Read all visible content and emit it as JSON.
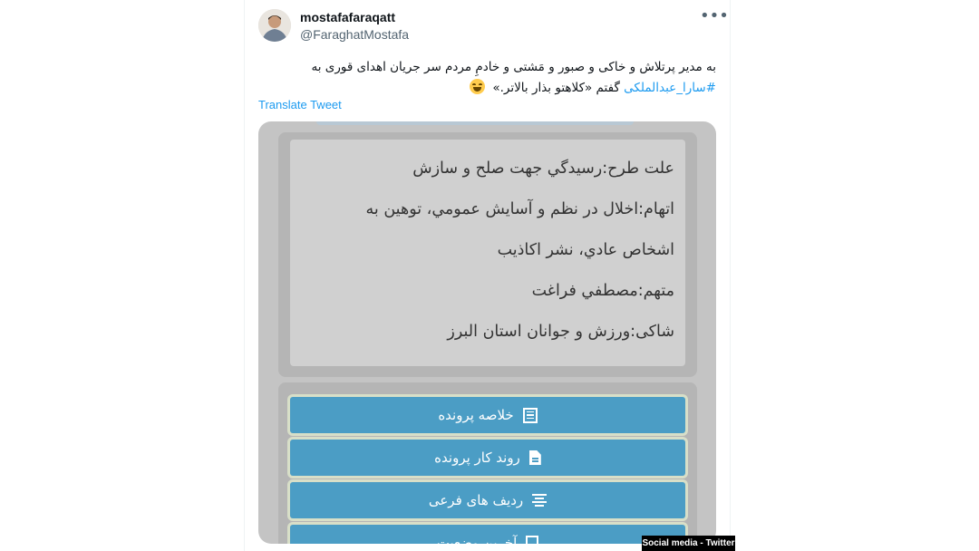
{
  "tweet": {
    "author": {
      "display_name": "mostafafaraqatt",
      "handle": "@FaraghatMostafa"
    },
    "more_icon": "more-horizontal-icon",
    "text_line1": "به مدیر پرتلاش و خاکی و صبور و مَشتی و خادمِ مردم سر جریان اهدای قوری به",
    "hashtag": "#سارا_عبدالملکی",
    "text_line2_rest": " گفتم «کلاهتو بذار بالاتر.»",
    "emoji": "grinning-face-emoji",
    "translate_label": "Translate Tweet"
  },
  "media": {
    "info_lines": [
      "علت طرح:رسيدگي جهت صلح و سازش",
      "اتهام:اخلال در نظم و آسايش عمومي، توهين به",
      "اشخاص عادي، نشر اكاذيب",
      "متهم:مصطفي فراغت",
      "شاكی:ورزش و جوانان استان البرز"
    ],
    "buttons": [
      {
        "label": "خلاصه پرونده",
        "icon": "list-icon"
      },
      {
        "label": "روند کار پرونده",
        "icon": "file-icon"
      },
      {
        "label": "رديف هاى فرعى",
        "icon": "align-center-icon"
      },
      {
        "label": "آخرین وضعیت",
        "icon": "document-icon"
      }
    ],
    "colors": {
      "button_bg": "#4b9dc5",
      "panel_bg": "#d0d0d0",
      "frame_bg": "#b5b5b5"
    }
  },
  "watermark": "Social media - Twitter"
}
